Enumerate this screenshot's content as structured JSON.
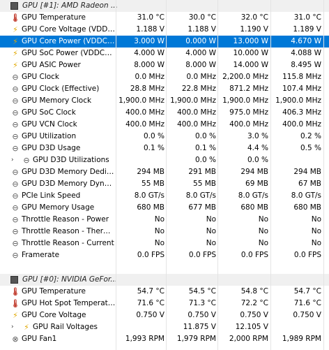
{
  "groups": [
    {
      "title": "GPU [#1]: AMD Radeon ...",
      "rows": [
        {
          "icon": "thermometer-icon",
          "cls": "temp",
          "glyph": "🌡",
          "label": "GPU Temperature",
          "v": [
            "31.0 °C",
            "30.0 °C",
            "32.0 °C",
            "31.0 °C"
          ]
        },
        {
          "icon": "lightning-icon",
          "cls": "volt",
          "glyph": "⚡",
          "label": "GPU Core Voltage (VDDC...",
          "v": [
            "1.188 V",
            "1.188 V",
            "1.190 V",
            "1.189 V"
          ]
        },
        {
          "icon": "lightning-icon",
          "cls": "volt",
          "glyph": "⚡",
          "label": "GPU Core Power (VDDCR...",
          "v": [
            "3.000 W",
            "0.000 W",
            "13.000 W",
            "4.670 W"
          ],
          "selected": true
        },
        {
          "icon": "lightning-icon",
          "cls": "volt",
          "glyph": "⚡",
          "label": "GPU SoC Power (VDDCR...",
          "v": [
            "4.000 W",
            "4.000 W",
            "10.000 W",
            "4.088 W"
          ]
        },
        {
          "icon": "lightning-icon",
          "cls": "volt",
          "glyph": "⚡",
          "label": "GPU ASIC Power",
          "v": [
            "8.000 W",
            "8.000 W",
            "14.000 W",
            "8.495 W"
          ]
        },
        {
          "icon": "clock-icon",
          "cls": "clock",
          "glyph": "⊖",
          "label": "GPU Clock",
          "v": [
            "0.0 MHz",
            "0.0 MHz",
            "2,200.0 MHz",
            "115.8 MHz"
          ]
        },
        {
          "icon": "clock-icon",
          "cls": "clock",
          "glyph": "⊖",
          "label": "GPU Clock (Effective)",
          "v": [
            "28.8 MHz",
            "22.8 MHz",
            "871.2 MHz",
            "107.4 MHz"
          ]
        },
        {
          "icon": "clock-icon",
          "cls": "clock",
          "glyph": "⊖",
          "label": "GPU Memory Clock",
          "v": [
            "1,900.0 MHz",
            "1,900.0 MHz",
            "1,900.0 MHz",
            "1,900.0 MHz"
          ]
        },
        {
          "icon": "clock-icon",
          "cls": "clock",
          "glyph": "⊖",
          "label": "GPU SoC Clock",
          "v": [
            "400.0 MHz",
            "400.0 MHz",
            "975.0 MHz",
            "406.3 MHz"
          ]
        },
        {
          "icon": "clock-icon",
          "cls": "clock",
          "glyph": "⊖",
          "label": "GPU VCN Clock",
          "v": [
            "400.0 MHz",
            "400.0 MHz",
            "400.0 MHz",
            "400.0 MHz"
          ]
        },
        {
          "icon": "usage-icon",
          "cls": "clock",
          "glyph": "⊖",
          "label": "GPU Utilization",
          "v": [
            "0.0 %",
            "0.0 %",
            "3.0 %",
            "0.2 %"
          ]
        },
        {
          "icon": "usage-icon",
          "cls": "clock",
          "glyph": "⊖",
          "label": "GPU D3D Usage",
          "v": [
            "0.1 %",
            "0.1 %",
            "4.4 %",
            "0.5 %"
          ]
        },
        {
          "icon": "usage-icon",
          "cls": "clock",
          "glyph": "⊖",
          "label": "GPU D3D Utilizations",
          "v": [
            "",
            "0.0 %",
            "0.0 %",
            ""
          ],
          "sub": true,
          "expander": "›"
        },
        {
          "icon": "memory-icon",
          "cls": "clock",
          "glyph": "⊖",
          "label": "GPU D3D Memory Dedica...",
          "v": [
            "294 MB",
            "291 MB",
            "294 MB",
            "294 MB"
          ]
        },
        {
          "icon": "memory-icon",
          "cls": "clock",
          "glyph": "⊖",
          "label": "GPU D3D Memory Dynamic",
          "v": [
            "55 MB",
            "55 MB",
            "69 MB",
            "67 MB"
          ]
        },
        {
          "icon": "link-speed-icon",
          "cls": "clock",
          "glyph": "⊖",
          "label": "PCIe Link Speed",
          "v": [
            "8.0 GT/s",
            "8.0 GT/s",
            "8.0 GT/s",
            "8.0 GT/s"
          ]
        },
        {
          "icon": "memory-icon",
          "cls": "clock",
          "glyph": "⊖",
          "label": "GPU Memory Usage",
          "v": [
            "680 MB",
            "677 MB",
            "680 MB",
            "680 MB"
          ]
        },
        {
          "icon": "throttle-icon",
          "cls": "clock",
          "glyph": "⊖",
          "label": "Throttle Reason - Power",
          "v": [
            "No",
            "No",
            "No",
            "No"
          ]
        },
        {
          "icon": "throttle-icon",
          "cls": "clock",
          "glyph": "⊖",
          "label": "Throttle Reason - Thermal",
          "v": [
            "No",
            "No",
            "No",
            "No"
          ]
        },
        {
          "icon": "throttle-icon",
          "cls": "clock",
          "glyph": "⊖",
          "label": "Throttle Reason - Current",
          "v": [
            "No",
            "No",
            "No",
            "No"
          ]
        },
        {
          "icon": "framerate-icon",
          "cls": "clock",
          "glyph": "⊖",
          "label": "Framerate",
          "v": [
            "0.0 FPS",
            "0.0 FPS",
            "0.0 FPS",
            "0.0 FPS"
          ]
        }
      ]
    },
    {
      "title": "GPU [#0]: NVIDIA GeFor...",
      "rows": [
        {
          "icon": "thermometer-icon",
          "cls": "temp",
          "glyph": "🌡",
          "label": "GPU Temperature",
          "v": [
            "54.7 °C",
            "54.5 °C",
            "54.8 °C",
            "54.7 °C"
          ]
        },
        {
          "icon": "thermometer-icon",
          "cls": "temp",
          "glyph": "🌡",
          "label": "GPU Hot Spot Temperature",
          "v": [
            "71.6 °C",
            "71.3 °C",
            "72.2 °C",
            "71.6 °C"
          ]
        },
        {
          "icon": "lightning-icon",
          "cls": "volt",
          "glyph": "⚡",
          "label": "GPU Core Voltage",
          "v": [
            "0.750 V",
            "0.750 V",
            "0.750 V",
            "0.750 V"
          ]
        },
        {
          "icon": "lightning-icon",
          "cls": "volt",
          "glyph": "⚡",
          "label": "GPU Rail Voltages",
          "v": [
            "",
            "11.875 V",
            "12.105 V",
            ""
          ],
          "sub": true,
          "expander": "›"
        },
        {
          "icon": "fan-icon",
          "cls": "clock",
          "glyph": "⊗",
          "label": "GPU Fan1",
          "v": [
            "1,993 RPM",
            "1,979 RPM",
            "2,000 RPM",
            "1,989 RPM"
          ]
        }
      ]
    }
  ]
}
